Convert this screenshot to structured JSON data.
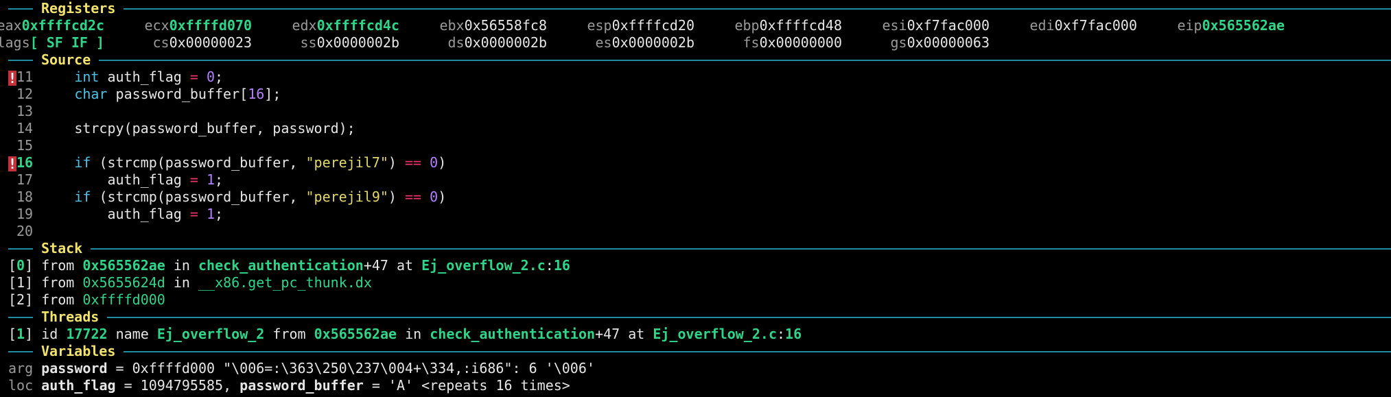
{
  "sections": {
    "registers": "Registers",
    "source": "Source",
    "stack": "Stack",
    "threads": "Threads",
    "variables": "Variables"
  },
  "registers": {
    "row1": [
      {
        "name": "eax",
        "value": "0xffffcd2c",
        "changed": true
      },
      {
        "name": "ecx",
        "value": "0xffffd070",
        "changed": true
      },
      {
        "name": "edx",
        "value": "0xffffcd4c",
        "changed": true
      },
      {
        "name": "ebx",
        "value": "0x56558fc8",
        "changed": false
      },
      {
        "name": "esp",
        "value": "0xffffcd20",
        "changed": false
      },
      {
        "name": "ebp",
        "value": "0xffffcd48",
        "changed": false
      },
      {
        "name": "esi",
        "value": "0xf7fac000",
        "changed": false
      },
      {
        "name": "edi",
        "value": "0xf7fac000",
        "changed": false
      },
      {
        "name": "eip",
        "value": "0x565562ae",
        "changed": true
      }
    ],
    "row2": [
      {
        "name": "eflags",
        "value": "[ SF IF ]",
        "changed": true
      },
      {
        "name": "cs",
        "value": "0x00000023",
        "changed": false
      },
      {
        "name": "ss",
        "value": "0x0000002b",
        "changed": false
      },
      {
        "name": "ds",
        "value": "0x0000002b",
        "changed": false
      },
      {
        "name": "es",
        "value": "0x0000002b",
        "changed": false
      },
      {
        "name": "fs",
        "value": "0x00000000",
        "changed": false
      },
      {
        "name": "gs",
        "value": "0x00000063",
        "changed": false
      }
    ]
  },
  "source": {
    "breakpoint_mark": "!",
    "lines": [
      {
        "no": "11",
        "bp": true,
        "current": false
      },
      {
        "no": "12",
        "bp": false,
        "current": false
      },
      {
        "no": "13",
        "bp": false,
        "current": false
      },
      {
        "no": "14",
        "bp": false,
        "current": false
      },
      {
        "no": "15",
        "bp": false,
        "current": false
      },
      {
        "no": "16",
        "bp": true,
        "current": true
      },
      {
        "no": "17",
        "bp": false,
        "current": false
      },
      {
        "no": "18",
        "bp": false,
        "current": false
      },
      {
        "no": "19",
        "bp": false,
        "current": false
      },
      {
        "no": "20",
        "bp": false,
        "current": false
      }
    ],
    "tokens": {
      "l11": {
        "kw": "int",
        "id": " auth_flag ",
        "op": "=",
        "num": "0",
        "end": ";"
      },
      "l12": {
        "kw": "char",
        "id": " password_buffer[",
        "num": "16",
        "end": "];"
      },
      "l14": {
        "text": "strcpy(password_buffer, password);"
      },
      "l16": {
        "kw": "if",
        "pre": " (strcmp(password_buffer, ",
        "str": "\"perejil7\"",
        "op": "==",
        "num": "0",
        "end": ")"
      },
      "l17": {
        "id": "auth_flag ",
        "op": "=",
        "num": "1",
        "end": ";"
      },
      "l18": {
        "kw": "if",
        "pre": " (strcmp(password_buffer, ",
        "str": "\"perejil9\"",
        "op": "==",
        "num": "0",
        "end": ")"
      },
      "l19": {
        "id": "auth_flag ",
        "op": "=",
        "num": "1",
        "end": ";"
      }
    }
  },
  "stack": {
    "frames": [
      {
        "idx": "0",
        "from": "from",
        "addr": "0x565562ae",
        "in": "in",
        "func": "check_authentication",
        "offset": "+47",
        "at": "at",
        "file": "Ej_overflow_2.c",
        "line": "16"
      },
      {
        "idx": "1",
        "from": "from",
        "addr": "0x5655624d",
        "in": "in",
        "func": "__x86.get_pc_thunk.dx"
      },
      {
        "idx": "2",
        "from": "from",
        "addr": "0xffffd000"
      }
    ]
  },
  "threads": {
    "items": [
      {
        "idx": "1",
        "id_label": "id",
        "id": "17722",
        "name_label": "name",
        "name": "Ej_overflow_2",
        "from": "from",
        "addr": "0x565562ae",
        "in": "in",
        "func": "check_authentication",
        "offset": "+47",
        "at": "at",
        "file": "Ej_overflow_2.c",
        "line": "16"
      }
    ]
  },
  "variables": {
    "arg": {
      "kind": "arg",
      "name": "password",
      "eq": " = ",
      "value": "0xffffd000 \"\\006=:\\363\\250\\237\\004+\\334,:i686\": 6 '\\006'"
    },
    "loc": {
      "kind": "loc",
      "name1": "auth_flag",
      "value1": " = 1094795585, ",
      "name2": "password_buffer",
      "value2": " = 'A' <repeats 16 times>"
    }
  },
  "colors": {
    "background": "#000000",
    "header": "#f2e36b",
    "rule": "#1f8ea3",
    "changed": "#2fd68a",
    "keyword": "#4fc2e5",
    "number": "#b380ff",
    "string": "#e3d86a",
    "operator": "#f0336d",
    "breakpoint": "#c2323a"
  }
}
